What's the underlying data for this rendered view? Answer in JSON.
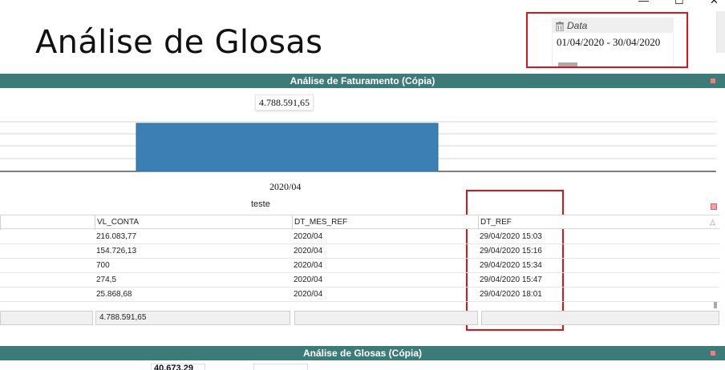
{
  "window_controls": {
    "minimize": "—",
    "maximize": "☐",
    "close": "✕"
  },
  "page_title": "Análise de Glosas",
  "filter": {
    "label": "Data",
    "value": "01/04/2020 - 30/04/2020",
    "icon": "trash-icon"
  },
  "panel1": {
    "title": "Análise de Faturamento (Cópia)"
  },
  "chart_data": {
    "type": "bar",
    "categories": [
      "2020/04"
    ],
    "values": [
      4788591.65
    ],
    "data_labels": [
      "4.788.591,65"
    ],
    "color": "#3b7fb5"
  },
  "table": {
    "caption": "teste",
    "columns": [
      "",
      "VL_CONTA",
      "DT_MES_REF",
      "DT_REF"
    ],
    "rows": [
      [
        "",
        "216.083,77",
        "2020/04",
        "29/04/2020 15:03"
      ],
      [
        "",
        "154.726,13",
        "2020/04",
        "29/04/2020 15:16"
      ],
      [
        "",
        "700",
        "2020/04",
        "29/04/2020 15:34"
      ],
      [
        "",
        "274,5",
        "2020/04",
        "29/04/2020 15:47"
      ],
      [
        "",
        "25.868,68",
        "2020/04",
        "29/04/2020 18:01"
      ]
    ],
    "totals": [
      "",
      "4.788.591,65",
      "",
      ""
    ],
    "sort_glyph": "△"
  },
  "panel2": {
    "title": "Análise de Glosas (Cópia)",
    "partial_value": "40.673,29"
  },
  "colors": {
    "header_bg": "#3d7b78",
    "highlight": "#e0131a",
    "bar": "#3b7fb5"
  }
}
